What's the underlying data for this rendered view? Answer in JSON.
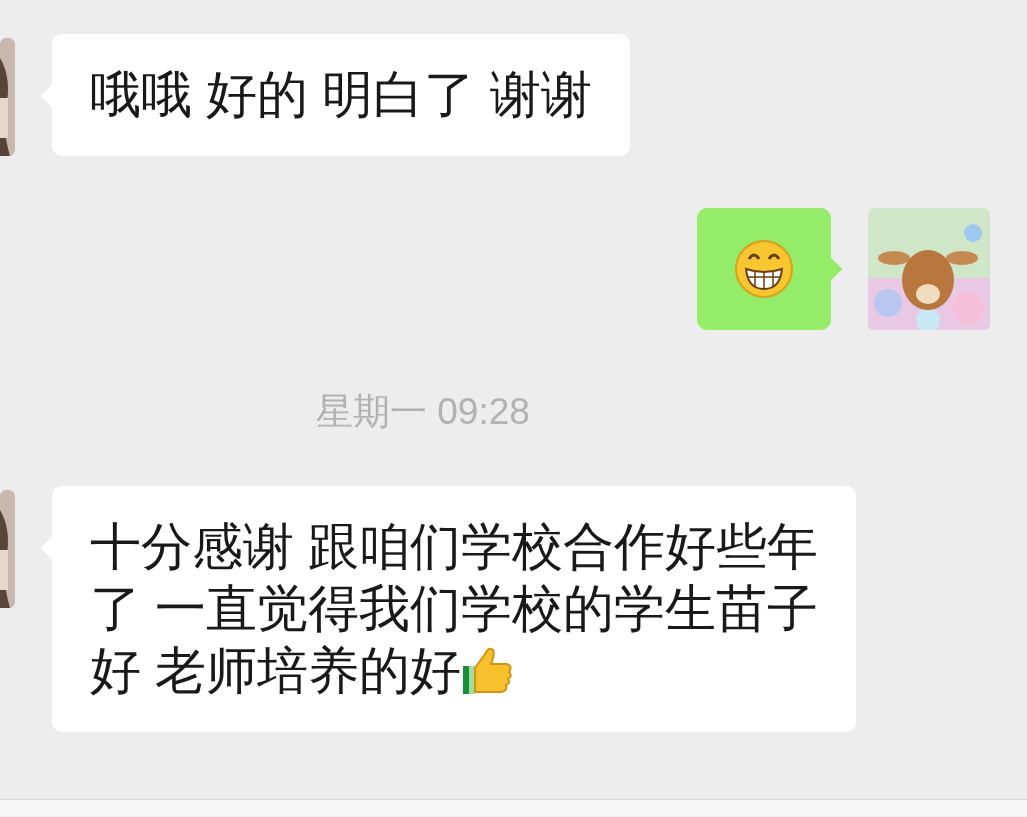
{
  "messages": [
    {
      "kind": "received_text",
      "lines": [
        "哦哦 好的 明白了 谢谢"
      ]
    },
    {
      "kind": "sent_emoji"
    },
    {
      "kind": "timestamp",
      "text": "星期一 09:28"
    },
    {
      "kind": "received_text",
      "lines": [
        "十分感谢 跟咱们学校合作好些年",
        "了 一直觉得我们学校的学生苗子",
        "好 老师培养的好"
      ],
      "thumb_after": true
    }
  ]
}
